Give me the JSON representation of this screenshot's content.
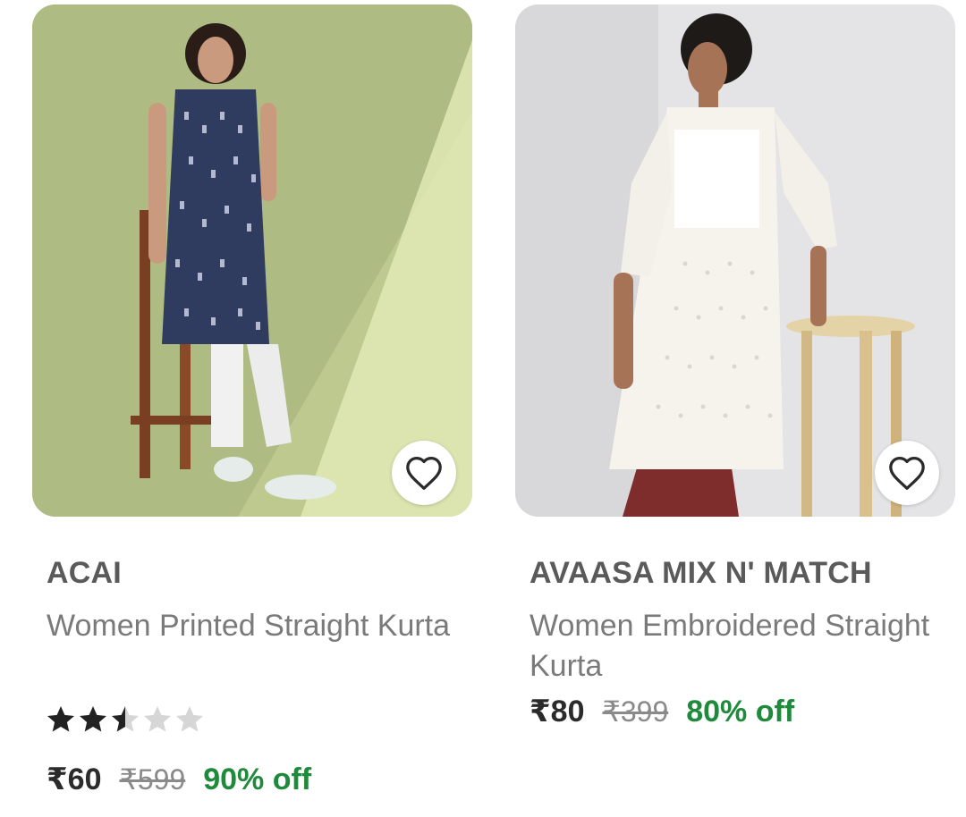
{
  "products": [
    {
      "brand": "ACAI",
      "title": "Women Printed Straight Kurta",
      "rating_stars": 2.5,
      "rating_max": 5,
      "price": "₹60",
      "mrp": "₹599",
      "discount": "90% off",
      "image": "model-in-navy-printed-sleeveless-kurta-with-stool"
    },
    {
      "brand": "AVAASA MIX N' MATCH",
      "title": "Women Embroidered Straight Kurta",
      "price": "₹80",
      "mrp": "₹399",
      "discount": "80% off",
      "image": "model-in-white-embroidered-kurta-with-stool"
    }
  ],
  "colors": {
    "discount": "#1f8a3b",
    "brand_text": "#5a5a5a",
    "title_text": "#7a7a7a",
    "star_filled": "#222222",
    "star_empty": "#d6d6d6"
  }
}
